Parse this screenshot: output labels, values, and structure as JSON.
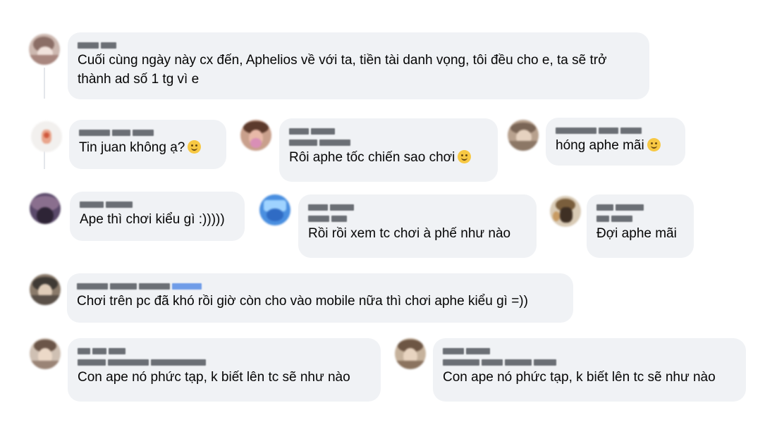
{
  "comments": [
    {
      "text": "Cuối cùng ngày này cx đến, Aphelios về với ta, tiền tài danh vọng, tôi đều cho e, ta sẽ trở thành ad số 1 tg vì e"
    },
    {
      "text": "Tin juan không ạ?",
      "emoji": "grinning-face-icon"
    },
    {
      "text": "Rôi aphe tốc chiến sao chơi",
      "emoji": "laughing-face-icon"
    },
    {
      "text": "hóng aphe mãi",
      "emoji": "smiling-face-icon"
    },
    {
      "text": "Ape thì chơi kiểu gì :)))))"
    },
    {
      "text": "Rồi rồi xem tc chơi à phế như nào"
    },
    {
      "text": "Đợi aphe mãi"
    },
    {
      "text": "Chơi trên pc đã khó rồi giờ còn cho vào mobile nữa thì chơi aphe kiểu gì =))"
    },
    {
      "text": "Con ape nó phức tạp, k biết lên tc sẽ như nào"
    },
    {
      "text": "Con ape nó phức tạp, k biết lên tc sẽ như nào"
    }
  ],
  "colors": {
    "bubble": "#f0f2f5",
    "text": "#050505",
    "redacted_name": "#6b6f75",
    "badge": "#6f9ce8"
  }
}
